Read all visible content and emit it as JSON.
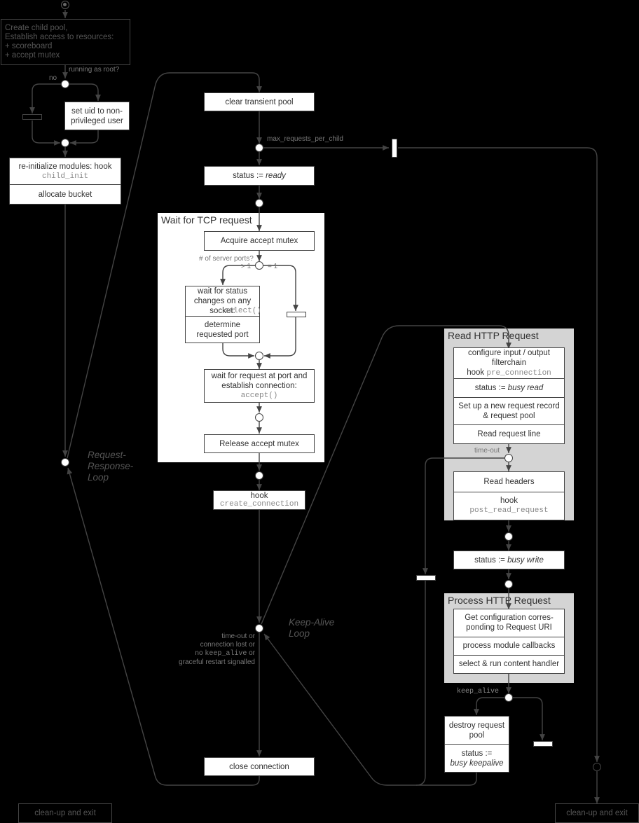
{
  "diagram": {
    "type": "activity-diagram",
    "groups": {
      "wait_tcp": {
        "title": "Wait for TCP request"
      },
      "read_http": {
        "title": "Read HTTP Request"
      },
      "process_http": {
        "title": "Process HTTP Request"
      }
    },
    "boxes": {
      "create_child_pool": [
        "Create child pool,",
        "Establish access to resources:",
        "+ scoreboard",
        "+ accept mutex"
      ],
      "set_uid": "set uid to non-privileged user",
      "reinit_modules": {
        "text": "re-initialize modules: hook",
        "code": "child_init"
      },
      "allocate_bucket": "allocate bucket",
      "clear_transient_pool": "clear transient pool",
      "status_ready": {
        "prefix": "status := ",
        "value": "ready"
      },
      "acquire_mutex": "Acquire accept mutex",
      "wait_status_changes": {
        "text": "wait for status changes on any socket:",
        "code": "select()"
      },
      "determine_port": "determine requested port",
      "wait_request": {
        "text": "wait for request at port and establish connection:",
        "code": "accept()"
      },
      "release_mutex": "Release accept mutex",
      "hook_create_connection": {
        "text": "hook",
        "code": "create_connection"
      },
      "configure_filterchain": {
        "text": "configure input / output filterchain",
        "hook": "hook ",
        "code": "pre_connection"
      },
      "status_busy_read": {
        "prefix": "status := ",
        "value": "busy read"
      },
      "setup_request_record": "Set up a new request record & request pool",
      "read_request_line": "Read request line",
      "read_headers": "Read headers",
      "hook_post_read": {
        "text": "hook",
        "code": "post_read_request"
      },
      "status_busy_write": {
        "prefix": "status := ",
        "value": "busy write"
      },
      "get_configuration": "Get configuration corres-ponding to Request URI",
      "process_callbacks": "process module callbacks",
      "run_content_handler": "select & run content handler",
      "destroy_request_pool": "destroy request pool",
      "status_busy_keepalive": {
        "prefix": "status :=",
        "value": "busy keepalive"
      },
      "close_connection": "close connection",
      "cleanup_exit_left": "clean-up and exit",
      "cleanup_exit_right": "clean-up and exit"
    },
    "labels": {
      "running_as_root": "running as root?",
      "no": "no",
      "max_requests": "max_requests_per_child",
      "server_ports": "# of server ports?",
      "gt1": "> 1",
      "eq1": "= 1",
      "time_out": "time-out",
      "keep_alive": "keep_alive",
      "exit_conditions": {
        "line1": "time-out or",
        "line2": "connection lost or",
        "line3_prefix": "no ",
        "line3_code": "keep_alive",
        "line3_suffix": " or",
        "line4": "graceful restart signalled"
      }
    },
    "loops": {
      "request_response": [
        "Request-",
        "Response-",
        "Loop"
      ],
      "keep_alive": [
        "Keep-Alive",
        "Loop"
      ]
    }
  }
}
